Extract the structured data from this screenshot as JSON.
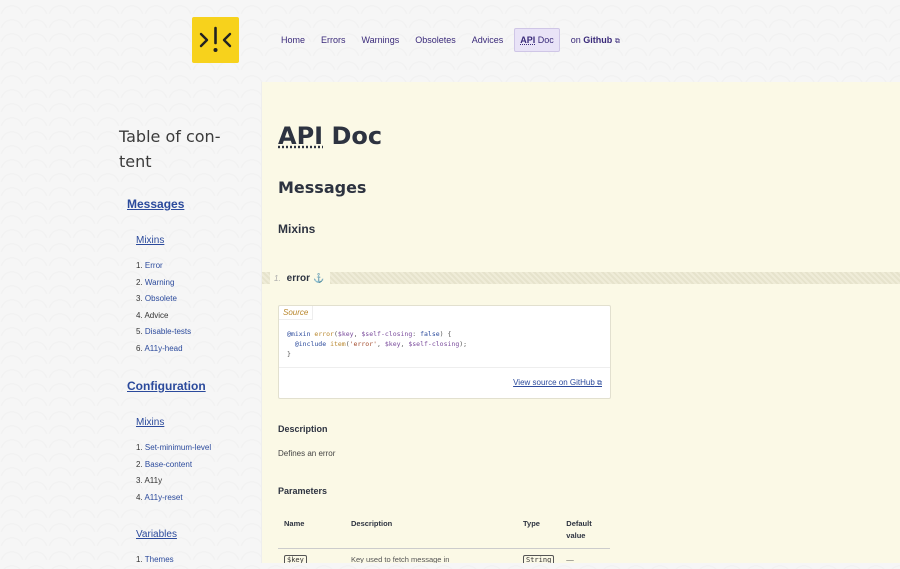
{
  "header": {
    "nav": [
      {
        "label": "Home"
      },
      {
        "label": "Errors"
      },
      {
        "label": "Warnings"
      },
      {
        "label": "Obsoletes"
      },
      {
        "label": "Advices"
      }
    ],
    "active": {
      "abbr": "API",
      "rest": " Doc"
    },
    "github": {
      "prefix": "on ",
      "label": "Github"
    }
  },
  "sidebar": {
    "title": "Table of con-tent",
    "sections": {
      "messages": "Messages",
      "messages_mixins": "Mixins",
      "messages_items": [
        "Error",
        "Warning",
        "Obsolete",
        "Advice",
        "Disable-tests",
        "A11y-head"
      ],
      "configuration": "Configuration",
      "configuration_mixins": "Mixins",
      "configuration_items": [
        "Set-minimum-level",
        "Base-content",
        "A11y",
        "A11y-reset"
      ],
      "configuration_variables": "Variables",
      "variables_items": [
        "Themes"
      ]
    }
  },
  "main": {
    "title_abbr": "API",
    "title_rest": " Doc",
    "section": "Messages",
    "subsection": "Mixins",
    "item": {
      "number": "1.",
      "name": "error"
    },
    "source_tab": "Source",
    "view_source": "View source on GitHub",
    "description_heading": "Description",
    "description": "Defines an error",
    "parameters_heading": "Parameters",
    "table": {
      "headers": [
        "Name",
        "Description",
        "Type",
        "Default value"
      ],
      "rows": [
        {
          "name": "$key",
          "description": "Key used to fetch message in",
          "type": "String",
          "default": "—"
        }
      ]
    }
  },
  "colors": {
    "logo": "#f7d21c",
    "link": "#2b4a9c",
    "main_bg": "#fbf9e6",
    "nav_active_bg": "#e9e3f7"
  }
}
